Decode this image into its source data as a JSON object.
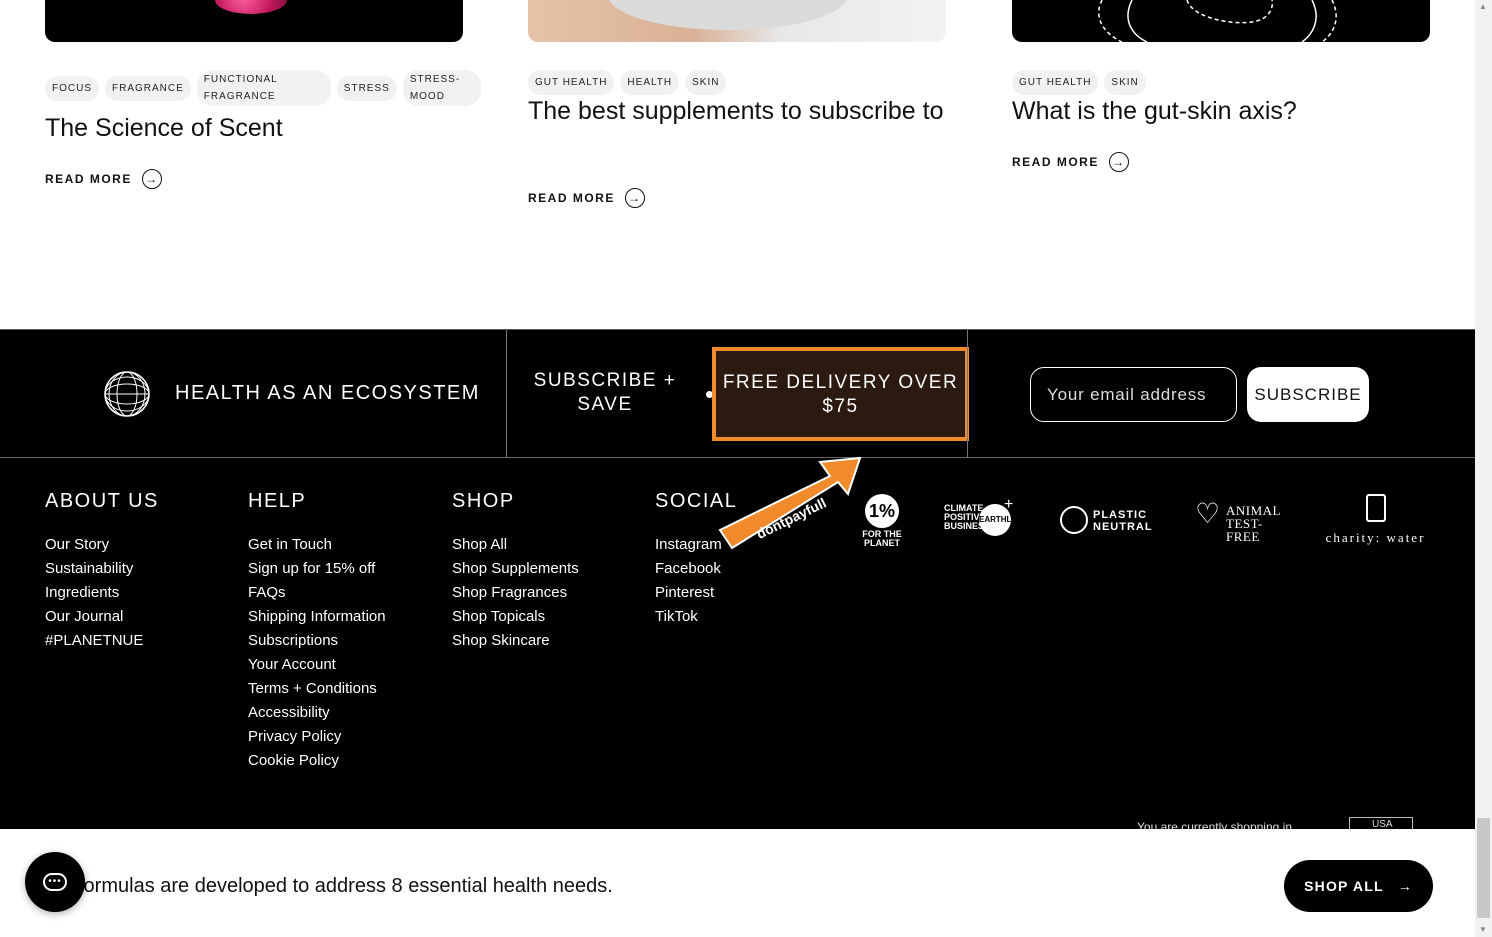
{
  "cards": [
    {
      "tags": [
        "FOCUS",
        "FRAGRANCE",
        "FUNCTIONAL FRAGRANCE",
        "STRESS",
        "STRESS-MOOD"
      ],
      "title": "The Science of Scent",
      "read_more": "READ MORE"
    },
    {
      "tags": [
        "GUT HEALTH",
        "HEALTH",
        "SKIN"
      ],
      "title": "The best supplements to subscribe to",
      "read_more": "READ MORE"
    },
    {
      "tags": [
        "GUT HEALTH",
        "SKIN"
      ],
      "title": "What is the gut-skin axis?",
      "read_more": "READ MORE"
    }
  ],
  "band": {
    "ecosystem": "HEALTH AS AN ECOSYSTEM",
    "subscribe_save": "SUBSCRIBE + SAVE",
    "free_delivery": "FREE DELIVERY OVER $75",
    "email_placeholder": "Your email address",
    "subscribe_button": "SUBSCRIBE"
  },
  "footer": {
    "about": {
      "heading": "ABOUT US",
      "links": [
        "Our Story",
        "Sustainability",
        "Ingredients",
        "Our Journal",
        "#PLANETNUE"
      ]
    },
    "help": {
      "heading": "HELP",
      "links": [
        "Get in Touch",
        "Sign up for 15% off",
        "FAQs",
        "Shipping Information",
        "Subscriptions",
        "Your Account",
        "Terms + Conditions",
        "Accessibility",
        "Privacy Policy",
        "Cookie Policy"
      ]
    },
    "shop": {
      "heading": "SHOP",
      "links": [
        "Shop All",
        "Shop Supplements",
        "Shop Fragrances",
        "Shop Topicals",
        "Shop Skincare"
      ]
    },
    "social": {
      "heading": "SOCIAL",
      "links": [
        "Instagram",
        "Facebook",
        "Pinterest",
        "TikTok"
      ]
    },
    "badges": {
      "one_percent": "1%",
      "one_percent_text": "FOR THE PLANET",
      "climate": "CLIMATE POSITIVE BUSINESS",
      "earthly": "EARTHLY",
      "plastic": "PLASTIC NEUTRAL",
      "animal": "ANIMAL TEST-FREE",
      "charity": "charity: water"
    },
    "country_text": "You are currently shopping in",
    "country_value": "USA"
  },
  "promo_overlay": "dontpayfull",
  "sticky": {
    "text": "formulas are developed to address 8 essential health needs.",
    "shop_all": "SHOP ALL"
  },
  "colors": {
    "black": "#000000",
    "accent_orange": "#f08a2b",
    "white": "#ffffff"
  }
}
